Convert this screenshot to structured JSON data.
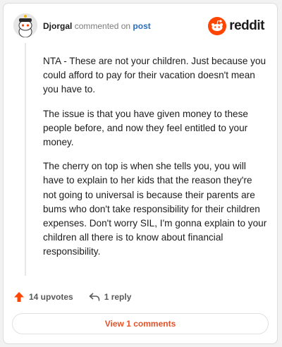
{
  "comment": {
    "username": "Djorgal",
    "action_text": "commented on",
    "post_link": "post",
    "paragraphs": [
      "NTA - These are not your children. Just because you could afford to pay for their vacation doesn't mean you have to.",
      "The issue is that you have given money to these people before, and now they feel entitled to your money.",
      "The cherry on top is when she tells you, you will have to explain to her kids that the reason they're not going to universal is because their parents are bums who don't take responsibility for their children expenses. Don't worry SIL, I'm gonna explain to your children all there is to know about financial responsibility."
    ],
    "upvotes_label": "14 upvotes",
    "replies_label": "1 reply",
    "view_comments_label": "View 1 comments"
  },
  "brand": {
    "logo_text": "reddit",
    "accent_color": "#ff4500",
    "link_color": "#2a6ebd"
  },
  "icons": {
    "logo": "reddit-snoo-icon",
    "upvote": "upvote-arrow-icon",
    "reply": "reply-arrow-icon",
    "avatar": "snoo-avatar-icon"
  }
}
